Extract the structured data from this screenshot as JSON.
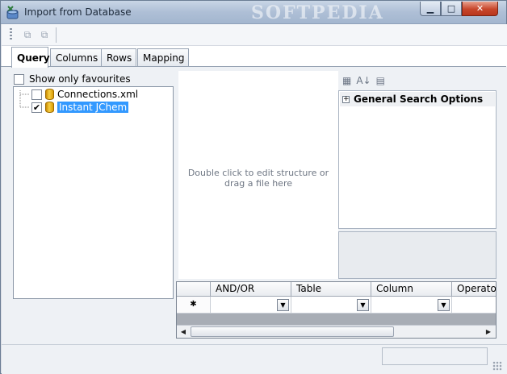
{
  "window": {
    "title": "Import from Database",
    "watermark": "SOFTPEDIA",
    "controls": {
      "minimize": "▁",
      "maximize": "□",
      "close": "✕"
    }
  },
  "toolbar": {
    "buttons": [
      {
        "name": "copy-icon",
        "glyph": "⧉",
        "enabled": false
      },
      {
        "name": "paste-icon",
        "glyph": "⧉",
        "enabled": false
      }
    ]
  },
  "tabs": [
    {
      "label": "Query",
      "active": true
    },
    {
      "label": "Columns",
      "active": false
    },
    {
      "label": "Rows",
      "active": false
    },
    {
      "label": "Mapping",
      "active": false
    }
  ],
  "query": {
    "favourites_label": "Show only favourites",
    "favourites_checked": false,
    "tree": [
      {
        "label": "Connections.xml",
        "checked": false,
        "selected": false
      },
      {
        "label": "Instant JChem",
        "checked": true,
        "selected": true
      }
    ],
    "editor_hint": "Double click to edit structure or drag a file here",
    "properties": {
      "category": "General Search Options",
      "sort_glyph": "A↓"
    },
    "grid": {
      "columns": [
        "AND/OR",
        "Table",
        "Column",
        "Operator"
      ],
      "new_row_marker": "✱",
      "dropdown_glyph": "▼"
    },
    "scroll": {
      "left": "◀",
      "right": "▶"
    }
  },
  "colors": {
    "selection": "#3399ff",
    "close_button": "#c7462b"
  }
}
